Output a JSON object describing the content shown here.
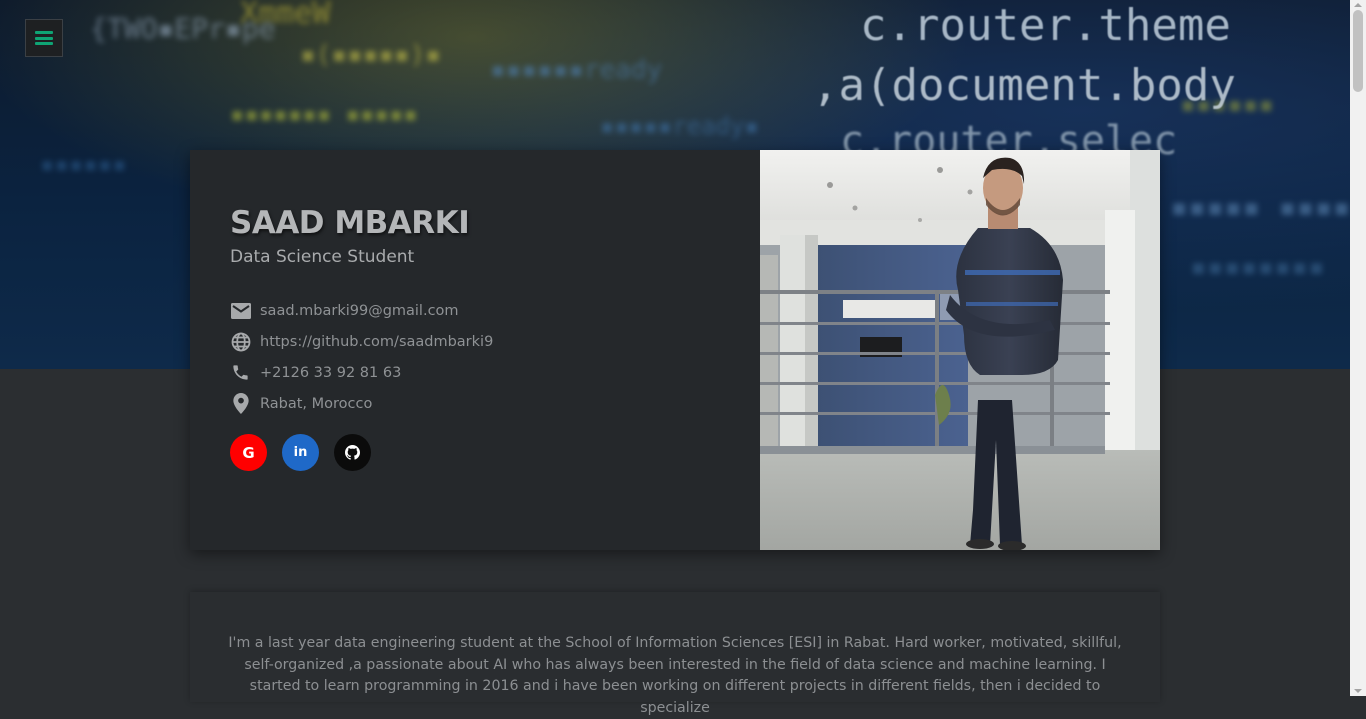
{
  "profile": {
    "name": "SAAD MBARKI",
    "title": "Data Science Student"
  },
  "contact": {
    "email": "saad.mbarki99@gmail.com",
    "website": "https://github.com/saadmbarki9",
    "phone": "+2126 33 92 81 63",
    "location": "Rabat, Morocco"
  },
  "social": {
    "google": "G",
    "linkedin": "in"
  },
  "hero_code": {
    "line1": "c.router.theme",
    "line2": ",a(document.body",
    "line3": "c.router.selec"
  },
  "about": {
    "text": "I'm a last year data engineering student at the School of Information Sciences [ESI] in Rabat. Hard worker, motivated, skillful, self-organized ,a passionate about AI who has always been interested in the field of data science and machine learning. I started to learn programming in 2016 and i have been working on different projects in different fields, then i decided to specialize"
  },
  "colors": {
    "accent": "#0fa474",
    "google": "#ff0000",
    "linkedin": "#1f69c8",
    "github": "#0b0b0b",
    "card": "#25282b",
    "page": "#2b2e31"
  }
}
